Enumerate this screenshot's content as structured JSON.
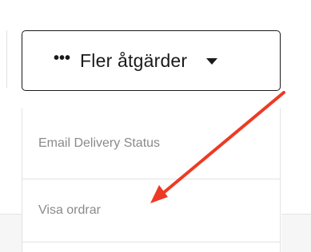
{
  "toolbar": {
    "more_actions_icon": "ellipsis-icon",
    "more_actions_label": "Fler åtgärder",
    "caret_icon": "caret-down-icon"
  },
  "menu": {
    "items": [
      {
        "label": "Email Delivery Status"
      },
      {
        "label": "Visa ordrar"
      },
      {
        "label": ""
      }
    ]
  },
  "annotation": {
    "arrow_color": "#ee3a24"
  }
}
